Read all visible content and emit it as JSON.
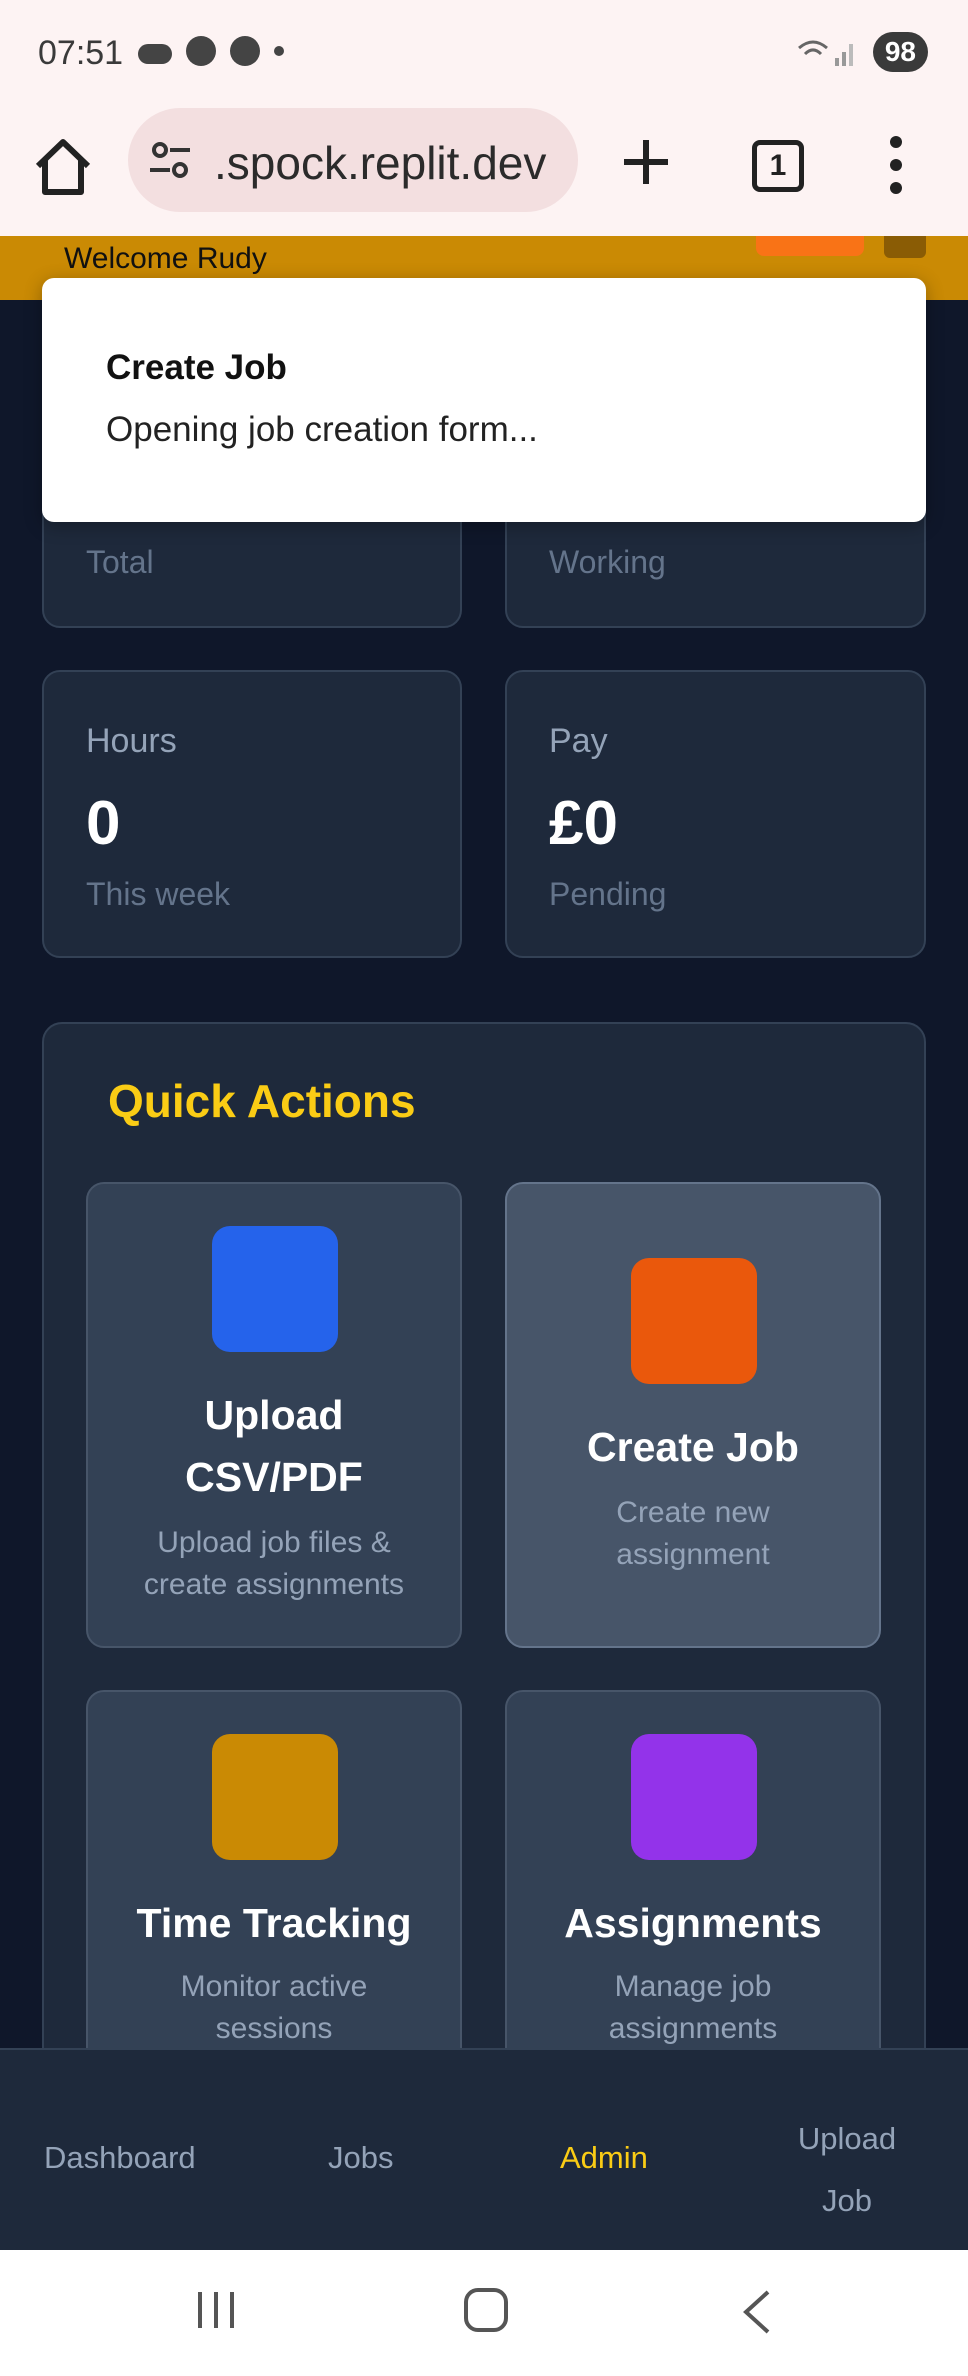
{
  "status_bar": {
    "time": "07:51",
    "battery": "98"
  },
  "browser": {
    "url": ".spock.replit.dev",
    "tab_count": "1"
  },
  "header": {
    "welcome": "Welcome Rudy"
  },
  "toast": {
    "title": "Create Job",
    "description": "Opening job creation form..."
  },
  "stats": [
    {
      "label": "",
      "value": "",
      "sub": "Total"
    },
    {
      "label": "",
      "value": "",
      "sub": "Working"
    },
    {
      "label": "Hours",
      "value": "0",
      "sub": "This week"
    },
    {
      "label": "Pay",
      "value": "£0",
      "sub": "Pending"
    }
  ],
  "quick_actions": {
    "title": "Quick Actions",
    "items": [
      {
        "name_line1": "Upload",
        "name_line2": "CSV/PDF",
        "desc_line1": "Upload job files &",
        "desc_line2": "create assignments",
        "color": "#2563eb"
      },
      {
        "name_line1": "Create Job",
        "desc_line1": "Create new",
        "desc_line2": "assignment",
        "color": "#ea580c"
      },
      {
        "name_line1": "Time Tracking",
        "desc_line1": "Monitor active",
        "desc_line2": "sessions",
        "color": "#ca8a04"
      },
      {
        "name_line1": "Assignments",
        "desc_line1": "Manage job",
        "desc_line2": "assignments",
        "color": "#9333ea"
      }
    ]
  },
  "bottom_nav": {
    "items": [
      {
        "label": "Dashboard"
      },
      {
        "label": "Jobs"
      },
      {
        "label": "Admin",
        "active": true
      },
      {
        "label_line1": "Upload",
        "label_line2": "Job"
      }
    ]
  }
}
